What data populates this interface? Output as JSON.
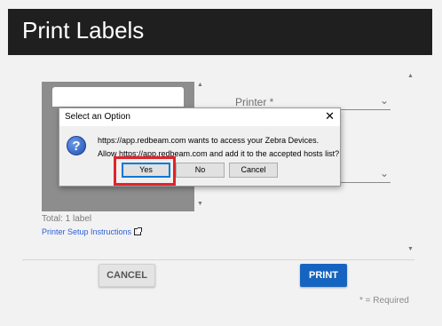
{
  "header": {
    "title": "Print Labels"
  },
  "form": {
    "printer_label": "Printer *",
    "total": "Total: 1 label",
    "setup_link": "Printer Setup Instructions"
  },
  "footer": {
    "cancel_label": "CANCEL",
    "print_label": "PRINT",
    "required_note": "* = Required"
  },
  "dialog": {
    "title": "Select an Option",
    "close": "✕",
    "message_line1": "https://app.redbeam.com wants to access your Zebra Devices.",
    "message_line2": "Allow https://app.redbeam.com and add it to the accepted hosts list?",
    "yes_label": "Yes",
    "no_label": "No",
    "cancel_label": "Cancel"
  },
  "icons": {
    "question": "?",
    "chevron": "⌄",
    "scroll_up": "▲",
    "scroll_down": "▼"
  },
  "colors": {
    "header_bg": "#1f1f1f",
    "print_button": "#1565c0",
    "link": "#2b5fd9",
    "highlight": "#e0242b"
  }
}
